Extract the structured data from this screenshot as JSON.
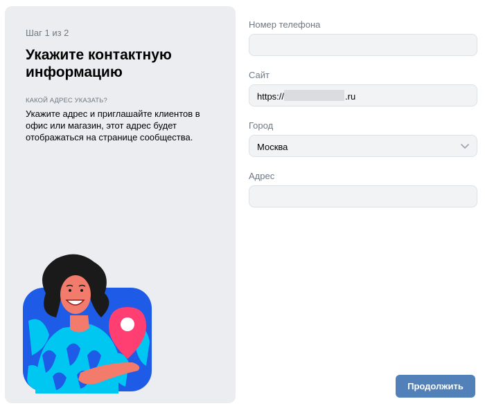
{
  "sidebar": {
    "step": "Шаг 1 из 2",
    "title": "Укажите контактную информацию",
    "hint_caption": "КАКОЙ АДРЕС УКАЗАТЬ?",
    "hint_text": "Укажите адрес и приглашайте клиентов в офис или магазин, этот адрес будет отображаться на странице сообщества."
  },
  "form": {
    "phone": {
      "label": "Номер телефона",
      "value": ""
    },
    "site": {
      "label": "Сайт",
      "prefix": "https://",
      "suffix": ".ru"
    },
    "city": {
      "label": "Город",
      "value": "Москва"
    },
    "address": {
      "label": "Адрес",
      "value": ""
    },
    "continue_label": "Продолжить"
  },
  "colors": {
    "accent": "#5181b8",
    "panel_bg": "#ebedf0",
    "field_bg": "#f2f3f5",
    "muted_text": "#6d7885"
  }
}
